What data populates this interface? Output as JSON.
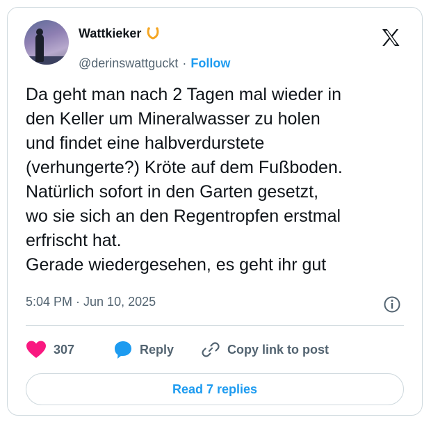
{
  "author": {
    "display_name": "Wattkieker",
    "badge_icon": "horseshoe-icon",
    "handle": "@derinswattguckt",
    "separator": "·",
    "follow_label": "Follow"
  },
  "platform_logo": "x-logo-icon",
  "tweet": {
    "text": "Da geht man nach 2 Tagen mal wieder in\nden Keller um Mineralwasser zu holen\nund findet eine halbverdurstete\n(verhungerte?) Kröte auf dem Fußboden.\nNatürlich sofort in den Garten gesetzt,\nwo sie sich an den Regentropfen erstmal\nerfrischt hat.\nGerade wiedergesehen, es geht ihr gut",
    "timestamp": "5:04 PM · Jun 10, 2025"
  },
  "actions": {
    "like_count": "307",
    "reply_label": "Reply",
    "copy_label": "Copy link to post"
  },
  "footer": {
    "read_replies_label": "Read 7 replies"
  },
  "colors": {
    "accent": "#1d9bf0",
    "like": "#f91880",
    "muted": "#536471",
    "text": "#0f1419",
    "border": "#cfd9de"
  }
}
